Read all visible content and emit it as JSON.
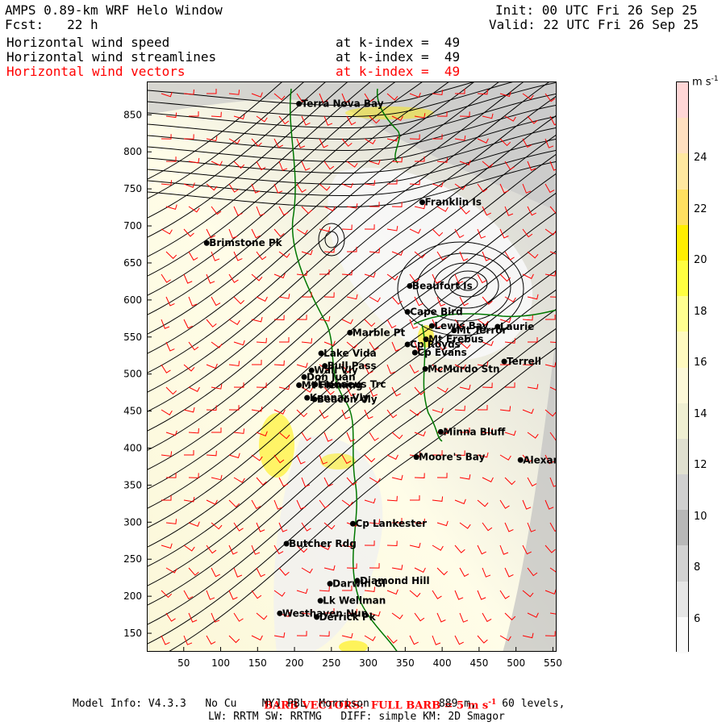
{
  "header": {
    "model_title": "AMPS 0.89-km WRF Helo Window",
    "forecast": "Fcst:   22 h",
    "init": "Init: 00 UTC Fri 26 Sep 25",
    "valid": "Valid: 22 UTC Fri 26 Sep 25",
    "fields": [
      {
        "name": "Horizontal wind speed",
        "level": "at k-index =  49",
        "color": "#000000"
      },
      {
        "name": "Horizontal wind streamlines",
        "level": "at k-index =  49",
        "color": "#000000"
      },
      {
        "name": "Horizontal wind vectors",
        "level": "at k-index =  49",
        "color": "#ff0000"
      }
    ]
  },
  "map": {
    "x_ticks": [
      50,
      100,
      150,
      200,
      250,
      300,
      350,
      400,
      450,
      500,
      550
    ],
    "y_ticks": [
      150,
      200,
      250,
      300,
      350,
      400,
      450,
      500,
      550,
      600,
      650,
      700,
      750,
      800,
      850
    ],
    "xlim": [
      0,
      555
    ],
    "ylim": [
      125,
      895
    ],
    "stations": [
      {
        "name": "Terra Nova Bay",
        "x": 205,
        "y": 866
      },
      {
        "name": "Franklin Is",
        "x": 372,
        "y": 733
      },
      {
        "name": "Brimstone Pk",
        "x": 80,
        "y": 678
      },
      {
        "name": "Beaufort Is",
        "x": 355,
        "y": 620
      },
      {
        "name": "Cape Bird",
        "x": 352,
        "y": 585
      },
      {
        "name": "Lewis Bay",
        "x": 385,
        "y": 566
      },
      {
        "name": "Laurie",
        "x": 474,
        "y": 565
      },
      {
        "name": "Mt Terror",
        "x": 415,
        "y": 560
      },
      {
        "name": "Marble Pt",
        "x": 274,
        "y": 557
      },
      {
        "name": "Cp Royds",
        "x": 352,
        "y": 541
      },
      {
        "name": "Mt Erebus",
        "x": 377,
        "y": 548
      },
      {
        "name": "Lake Vida",
        "x": 235,
        "y": 529
      },
      {
        "name": "Cp Evans",
        "x": 362,
        "y": 530
      },
      {
        "name": "Terrell",
        "x": 483,
        "y": 518
      },
      {
        "name": "Wall Vly",
        "x": 222,
        "y": 506
      },
      {
        "name": "Bull Pass",
        "x": 240,
        "y": 512
      },
      {
        "name": "McMurdo Stn",
        "x": 376,
        "y": 508
      },
      {
        "name": "Don Juan",
        "x": 212,
        "y": 497
      },
      {
        "name": "Linnaeus Trc",
        "x": 227,
        "y": 487
      },
      {
        "name": "Mt Fleming",
        "x": 205,
        "y": 486
      },
      {
        "name": "Kennar Vly",
        "x": 216,
        "y": 469
      },
      {
        "name": "Beacon Vly",
        "x": 226,
        "y": 467
      },
      {
        "name": "Minna Bluff",
        "x": 397,
        "y": 423
      },
      {
        "name": "Moore's Bay",
        "x": 364,
        "y": 389
      },
      {
        "name": "Alexander",
        "x": 505,
        "y": 385
      },
      {
        "name": "Cp Lankester",
        "x": 278,
        "y": 299
      },
      {
        "name": "Butcher Rdg",
        "x": 188,
        "y": 272
      },
      {
        "name": "Darwin Gl",
        "x": 247,
        "y": 218
      },
      {
        "name": "Diamond Hill",
        "x": 284,
        "y": 222
      },
      {
        "name": "Lk Wellman",
        "x": 234,
        "y": 195
      },
      {
        "name": "Westhaven Nun",
        "x": 179,
        "y": 178
      },
      {
        "name": "Derrick Pk",
        "x": 229,
        "y": 173
      }
    ]
  },
  "colorbar": {
    "unit": "m s",
    "unit_sup": "-1",
    "labels": [
      "24",
      "22",
      "20",
      "18",
      "16",
      "14",
      "12",
      "10",
      "8",
      "6"
    ],
    "colors": [
      "#ffd6d6",
      "#ffe0c0",
      "#ffe8a0",
      "#ffe060",
      "#ffee00",
      "#ffff40",
      "#ffff90",
      "#fffac0",
      "#fcf8d8",
      "#efefd2",
      "#e0e0d0",
      "#d0d0d0",
      "#b8b8b8",
      "#d2d2d2",
      "#e6e6e6",
      "#fafafa"
    ]
  },
  "footer": {
    "barb_note": "BARB VECTORS:  FULL BARB = 5 m s",
    "barb_sup": "-1",
    "model_info": "Model Info: V4.3.3   No Cu    MYJ PBL  Morrison           889 m,    60 levels,",
    "physics": "LW: RRTM SW: RRTMG   DIFF: simple KM: 2D Smagor"
  }
}
